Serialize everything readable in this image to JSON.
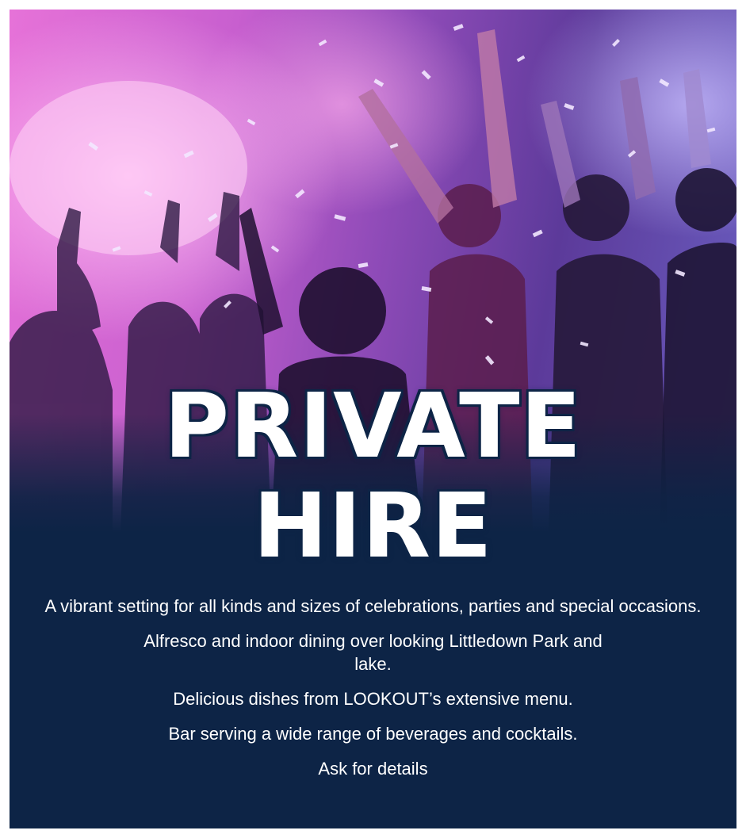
{
  "hero": {
    "image_icon": "party-crowd-photo",
    "accent_colors": [
      "#e672d8",
      "#8f4bb8",
      "#0d2446"
    ]
  },
  "title": {
    "line1": "PRIVATE",
    "line2": "HIRE"
  },
  "details": [
    "A vibrant setting for all kinds and sizes of celebrations, parties and special occasions.",
    "Alfresco and indoor dining over looking Littledown Park and lake.",
    "Delicious dishes from LOOKOUT’s extensive menu.",
    "Bar serving a wide range of beverages and cocktails.",
    "Ask for details"
  ],
  "colors": {
    "background": "#0d2446",
    "text": "#ffffff"
  }
}
